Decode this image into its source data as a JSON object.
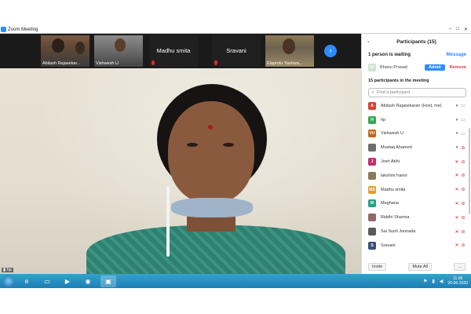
{
  "window": {
    "title": "Zoom Meeting",
    "controls": [
      "–",
      "□",
      "✕"
    ]
  },
  "gallery": {
    "tiles": [
      {
        "name": "Abilash Rajasekar...",
        "has_video": true
      },
      {
        "name": "Vishwesh U",
        "has_video": true
      },
      {
        "name": "Madhu smita",
        "has_video": false
      },
      {
        "name": "Sravani",
        "has_video": false
      },
      {
        "name": "Elaprolu Yashwa...",
        "has_video": true
      }
    ],
    "next_arrow": "›"
  },
  "speaker": {
    "label": "hp"
  },
  "participants_panel": {
    "title": "Participants (15)",
    "waiting": {
      "label": "1 person is waiting",
      "message_label": "Message",
      "person": {
        "name": "Bhanu Prasad",
        "initials": "BP"
      },
      "admit_label": "Admit",
      "remove_label": "Remove"
    },
    "count_label": "15 participants in the meeting",
    "search_placeholder": "Find a participant",
    "participants": [
      {
        "initials": "A",
        "name": "Abilash Rajasekaran (Host, me)",
        "color": "#d9432f",
        "mic_muted": false,
        "cam_off": false
      },
      {
        "initials": "H",
        "name": "hp",
        "color": "#3aa655",
        "mic_muted": false,
        "cam_off": false
      },
      {
        "initials": "VU",
        "name": "Vishwesh U",
        "color": "#c2661d",
        "mic_muted": false,
        "cam_off": false
      },
      {
        "initials": "",
        "name": "Mustaq Ahamed",
        "color": "#6d6d6d",
        "mic_muted": false,
        "cam_off": true
      },
      {
        "initials": "J",
        "name": "Josh Abhi",
        "color": "#c0306b",
        "mic_muted": true,
        "cam_off": true
      },
      {
        "initials": "",
        "name": "lakshmi harini",
        "color": "#8a7a5a",
        "mic_muted": true,
        "cam_off": true
      },
      {
        "initials": "MS",
        "name": "Madhu smita",
        "color": "#e0a02a",
        "mic_muted": true,
        "cam_off": true
      },
      {
        "initials": "M",
        "name": "Meghana",
        "color": "#25a085",
        "mic_muted": true,
        "cam_off": true
      },
      {
        "initials": "",
        "name": "Riddhi Sharma",
        "color": "#8f6a6a",
        "mic_muted": true,
        "cam_off": true
      },
      {
        "initials": "",
        "name": "Sai Sunil Jonnada",
        "color": "#5a5a5a",
        "mic_muted": true,
        "cam_off": true
      },
      {
        "initials": "S",
        "name": "Sravani",
        "color": "#3a4f7a",
        "mic_muted": true,
        "cam_off": true
      }
    ],
    "footer": {
      "invite_label": "Invite",
      "mute_all_label": "Mute All",
      "more_label": "..."
    }
  },
  "taskbar": {
    "items": [
      {
        "icon": "internet-explorer-icon",
        "glyph": "e"
      },
      {
        "icon": "file-explorer-icon",
        "glyph": "▭"
      },
      {
        "icon": "media-player-icon",
        "glyph": "▶"
      },
      {
        "icon": "chrome-icon",
        "glyph": "◉"
      },
      {
        "icon": "zoom-icon",
        "glyph": "▣"
      }
    ],
    "time": "11:06",
    "date": "26-06-2020"
  }
}
